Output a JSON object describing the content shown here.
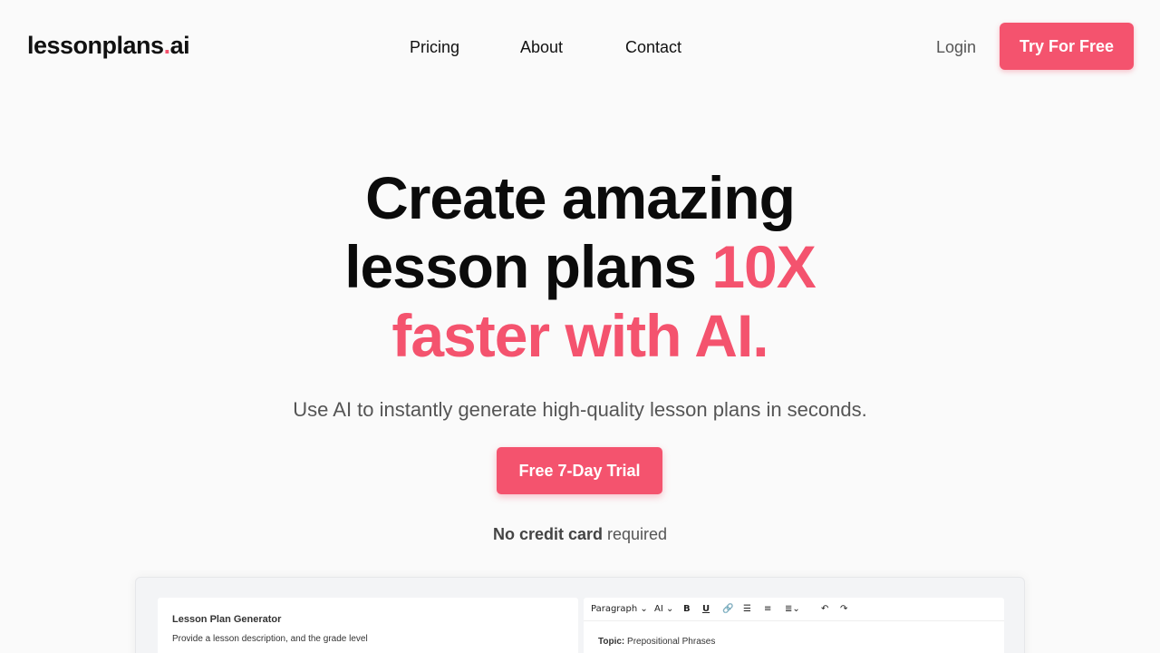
{
  "header": {
    "logo_text": "lessonplans",
    "logo_dot": ".",
    "logo_suffix": "ai",
    "nav": [
      {
        "label": "Pricing"
      },
      {
        "label": "About"
      },
      {
        "label": "Contact"
      }
    ],
    "login_label": "Login",
    "cta_label": "Try For Free"
  },
  "hero": {
    "title_line1": "Create amazing",
    "title_line2_plain": "lesson plans ",
    "title_line2_accent": "10X",
    "title_line3_accent": "faster with AI.",
    "subtitle": "Use AI to instantly generate high-quality lesson plans in seconds.",
    "cta_label": "Free 7-Day Trial",
    "note_bold": "No credit card",
    "note_rest": " required"
  },
  "preview": {
    "generator_title": "Lesson Plan Generator",
    "generator_desc": "Provide a lesson description, and the grade level",
    "toolbar": {
      "paragraph": "Paragraph",
      "ai": "AI",
      "bold": "B",
      "underline": "U"
    },
    "topic_label": "Topic:",
    "topic_value": " Prepositional Phrases"
  },
  "colors": {
    "accent": "#f4536e",
    "background": "#fafafa"
  }
}
